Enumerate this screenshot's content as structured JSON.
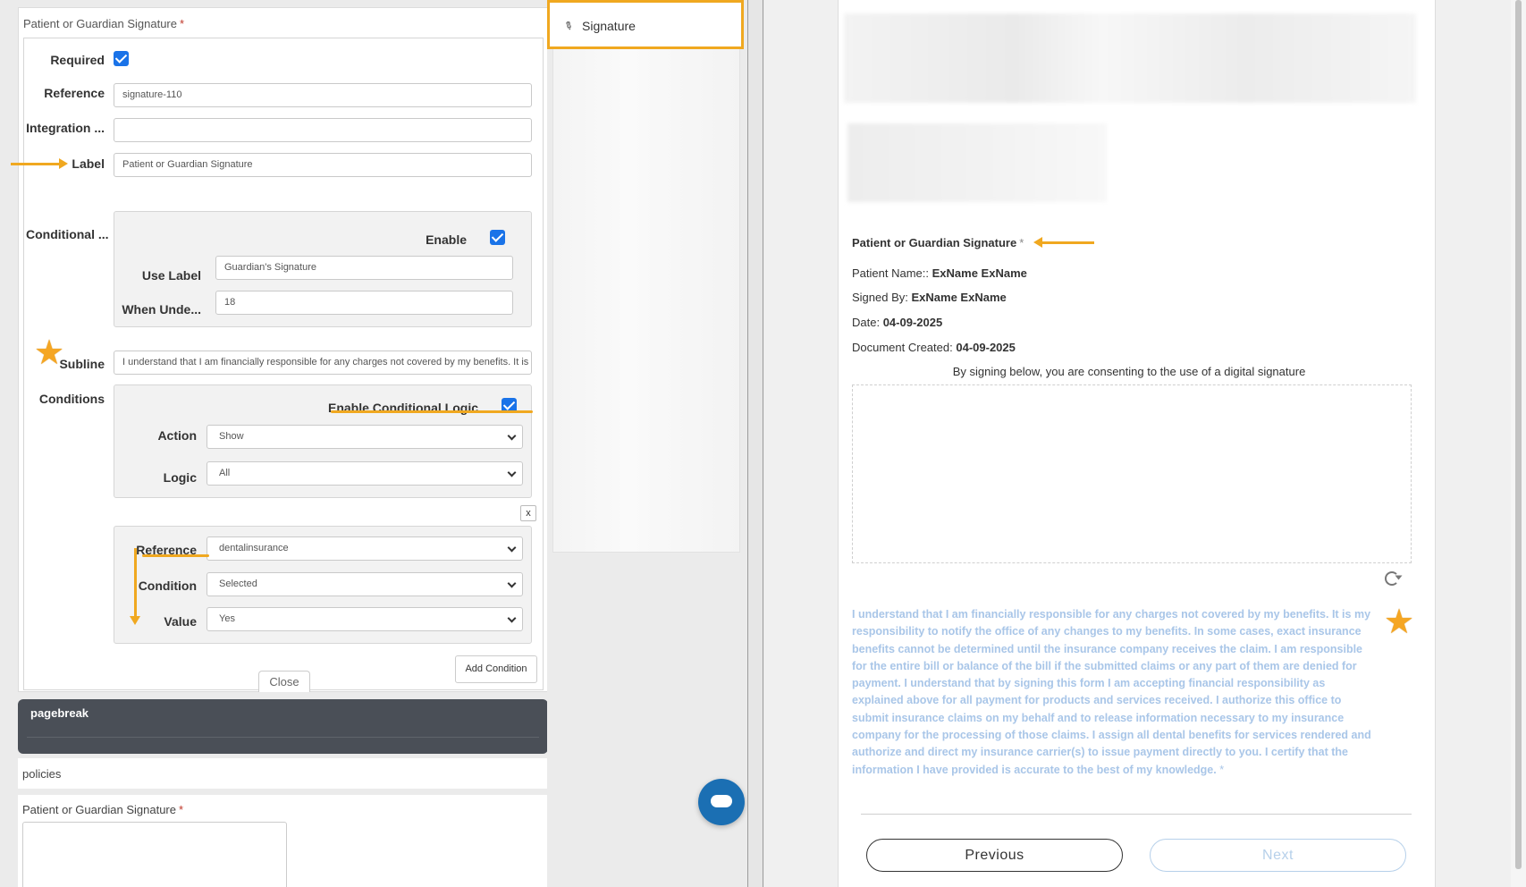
{
  "editor": {
    "field_title": "Patient or Guardian Signature",
    "required_mark": "*",
    "labels": {
      "required": "Required",
      "reference": "Reference",
      "integration": "Integration ...",
      "label": "Label",
      "conditional": "Conditional ...",
      "subline": "Subline",
      "conditions": "Conditions"
    },
    "values": {
      "required_checked": true,
      "reference": "signature-110",
      "integration": "",
      "label": "Patient or Guardian Signature",
      "subline": "I understand that I am financially responsible for any charges not covered by my benefits. It is"
    },
    "conditional_label": {
      "enable_label": "Enable",
      "enable_checked": true,
      "use_label_label": "Use Label",
      "use_label_value": "Guardian's Signature",
      "when_under_label": "When Unde...",
      "when_under_value": "18"
    },
    "conditional_logic": {
      "enable_label": "Enable Conditional Logic",
      "enable_checked": true,
      "action_label": "Action",
      "action_value": "Show",
      "logic_label": "Logic",
      "logic_value": "All",
      "remove_label": "x",
      "condition": {
        "reference_label": "Reference",
        "reference_value": "dentalinsurance",
        "condition_label": "Condition",
        "condition_value": "Selected",
        "value_label": "Value",
        "value_value": "Yes"
      },
      "add_condition_label": "Add Condition"
    },
    "close_label": "Close",
    "pagebreak_label": "pagebreak",
    "policies_label": "policies",
    "bottom_field_title": "Patient or Guardian Signature",
    "bottom_required_mark": "*"
  },
  "palette": {
    "signature_icon": "pen-icon",
    "signature_label": "Signature"
  },
  "preview": {
    "title": "Patient or Guardian Signature",
    "required_mark": "*",
    "patient_name_label": "Patient Name::",
    "patient_name_value": "ExName ExName",
    "signed_by_label": "Signed By:",
    "signed_by_value": "ExName ExName",
    "date_label": "Date:",
    "date_value": "04-09-2025",
    "doc_created_label": "Document Created:",
    "doc_created_value": "04-09-2025",
    "consent_text": "By signing below, you are consenting to the use of a digital signature",
    "subline_text": "I understand that I am financially responsible for any charges not covered by my benefits. It is my responsibility to notify the office of any changes to my benefits. In some cases, exact insurance benefits cannot be determined until the insurance company receives the claim. I am responsible for the entire bill or balance of the bill if the submitted claims or any part of them are denied for payment. I understand that by signing this form I am accepting financial responsibility as explained above for all payment for products and services received. I authorize this office to submit insurance claims on my behalf and to release information necessary to my insurance company for the processing of those claims. I assign all dental benefits for services rendered and authorize and direct my insurance carrier(s) to issue payment directly to you. I certify that the information I have provided is accurate to the best of my knowledge.",
    "subline_required_mark": "*",
    "previous_label": "Previous",
    "next_label": "Next"
  },
  "colors": {
    "accent_annotation": "#f0a820",
    "checkbox_blue": "#1a73e8",
    "subline_text": "#a9c6e8",
    "pagebreak_bg": "#4a4f57",
    "chat_bubble": "#1b6fb3"
  }
}
